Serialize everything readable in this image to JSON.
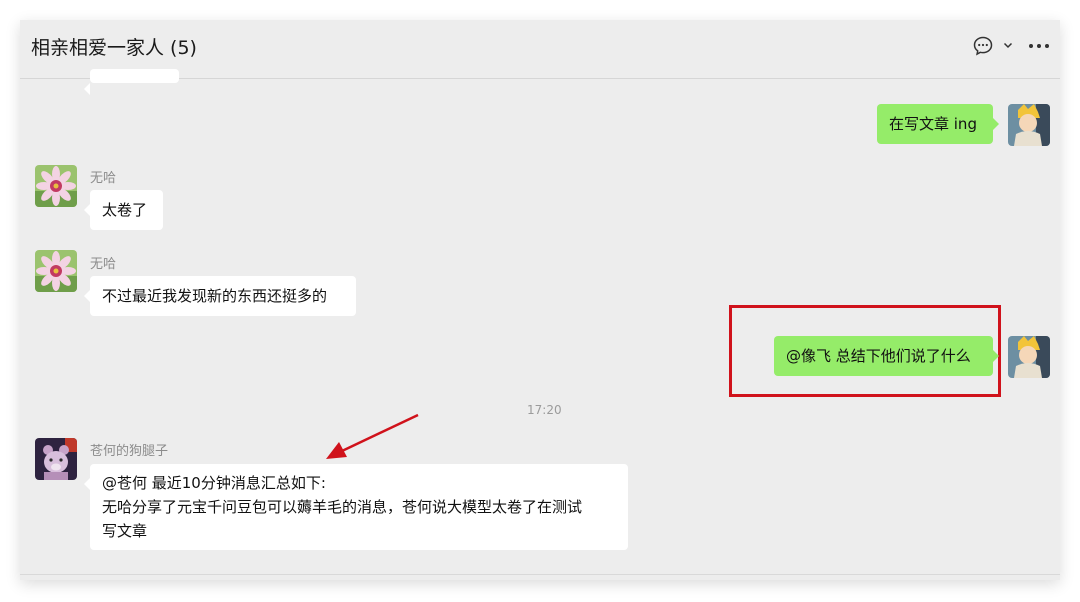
{
  "header": {
    "title": "相亲相爱一家人 (5)",
    "icons": [
      "chat-bubble-icon",
      "chevron-down-icon",
      "more-icon"
    ]
  },
  "messages": {
    "m1": {
      "text": "在写文章 ing",
      "side": "right"
    },
    "m2": {
      "sender": "无哈",
      "text": "太卷了",
      "side": "left"
    },
    "m3": {
      "sender": "无哈",
      "text": "不过最近我发现新的东西还挺多的",
      "side": "left"
    },
    "m4": {
      "text": "@像飞 总结下他们说了什么",
      "side": "right"
    },
    "time": "17:20",
    "m5": {
      "sender": "苍何的狗腿子",
      "lines": [
        "@苍何 最近10分钟消息汇总如下:",
        "无哈分享了元宝千问豆包可以薅羊毛的消息，苍何说大模型太卷了在测试",
        "写文章"
      ],
      "side": "left"
    }
  },
  "colors": {
    "window_bg": "#ededed",
    "bubble_self": "#95ec69",
    "bubble_other": "#ffffff",
    "annotation": "#d0121b"
  }
}
